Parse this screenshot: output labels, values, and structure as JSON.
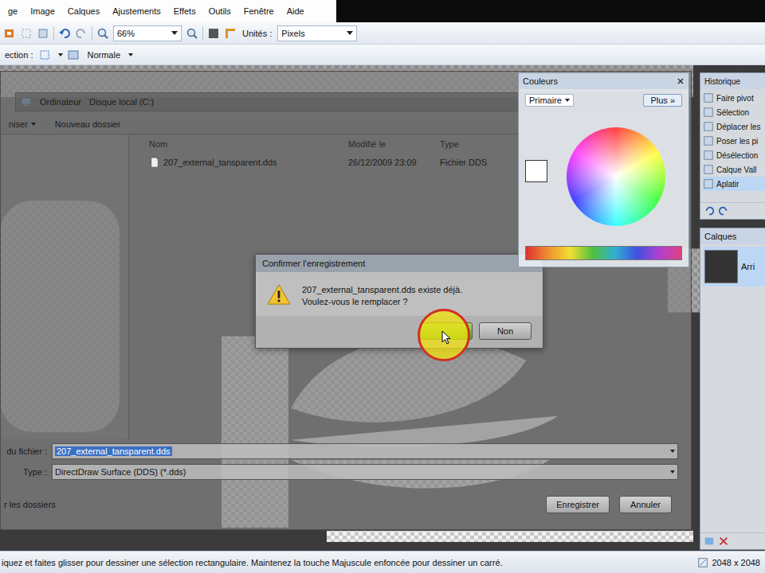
{
  "menu": [
    "ge",
    "Image",
    "Calques",
    "Ajustements",
    "Effets",
    "Outils",
    "Fenêtre",
    "Aide"
  ],
  "toolbar": {
    "zoom": "66%",
    "units_label": "Unités :",
    "units": "Pixels",
    "selection_label": "ection :",
    "blend_mode": "Normale"
  },
  "save_dialog": {
    "breadcrumb": [
      "Ordinateur",
      "Disque local (C:)"
    ],
    "organize": "niser",
    "new_folder": "Nouveau dossier",
    "columns": [
      "Nom",
      "Modifié le",
      "Type"
    ],
    "files": [
      {
        "name": "207_external_tansparent.dds",
        "modified": "26/12/2009 23:09",
        "type": "Fichier DDS"
      }
    ],
    "filename_label": "du fichier :",
    "filename": "207_external_tansparent.dds",
    "filename_selected": true,
    "type_label": "Type :",
    "type": "DirectDraw Surface (DDS) (*.dds)",
    "hide_folders": "r les dossiers",
    "buttons": [
      "Enregistrer",
      "Annuler"
    ]
  },
  "confirm_dialog": {
    "title": "Confirmer l'enregistrement",
    "message": [
      "207_external_tansparent.dds existe déjà.",
      "Voulez-vous le remplacer ?"
    ],
    "buttons": [
      {
        "label": "Non",
        "selected": false
      }
    ],
    "cursor_highlight": true
  },
  "colors_window": {
    "title": "Couleurs",
    "mode": "Primaire",
    "more": "Plus »"
  },
  "history_window": {
    "title": "Historique",
    "items": [
      {
        "label": "Faire pivot",
        "selected": false
      },
      {
        "label": "Sélection",
        "selected": false
      },
      {
        "label": "Déplacer les",
        "selected": false
      },
      {
        "label": "Poser les pi",
        "selected": false
      },
      {
        "label": "Désélection",
        "selected": false
      },
      {
        "label": "Calque Vall",
        "selected": false
      },
      {
        "label": "Aplatir",
        "selected": true
      }
    ]
  },
  "layers_window": {
    "title": "Calques",
    "layers": [
      {
        "name": "Arri",
        "selected": true
      }
    ]
  },
  "status_bar": {
    "hint": "iquez et faites glisser pour dessiner une sélection rectangulaire. Maintenez la touche Majuscule enfoncée pour dessiner un carré.",
    "size": "2048 x 2048"
  }
}
